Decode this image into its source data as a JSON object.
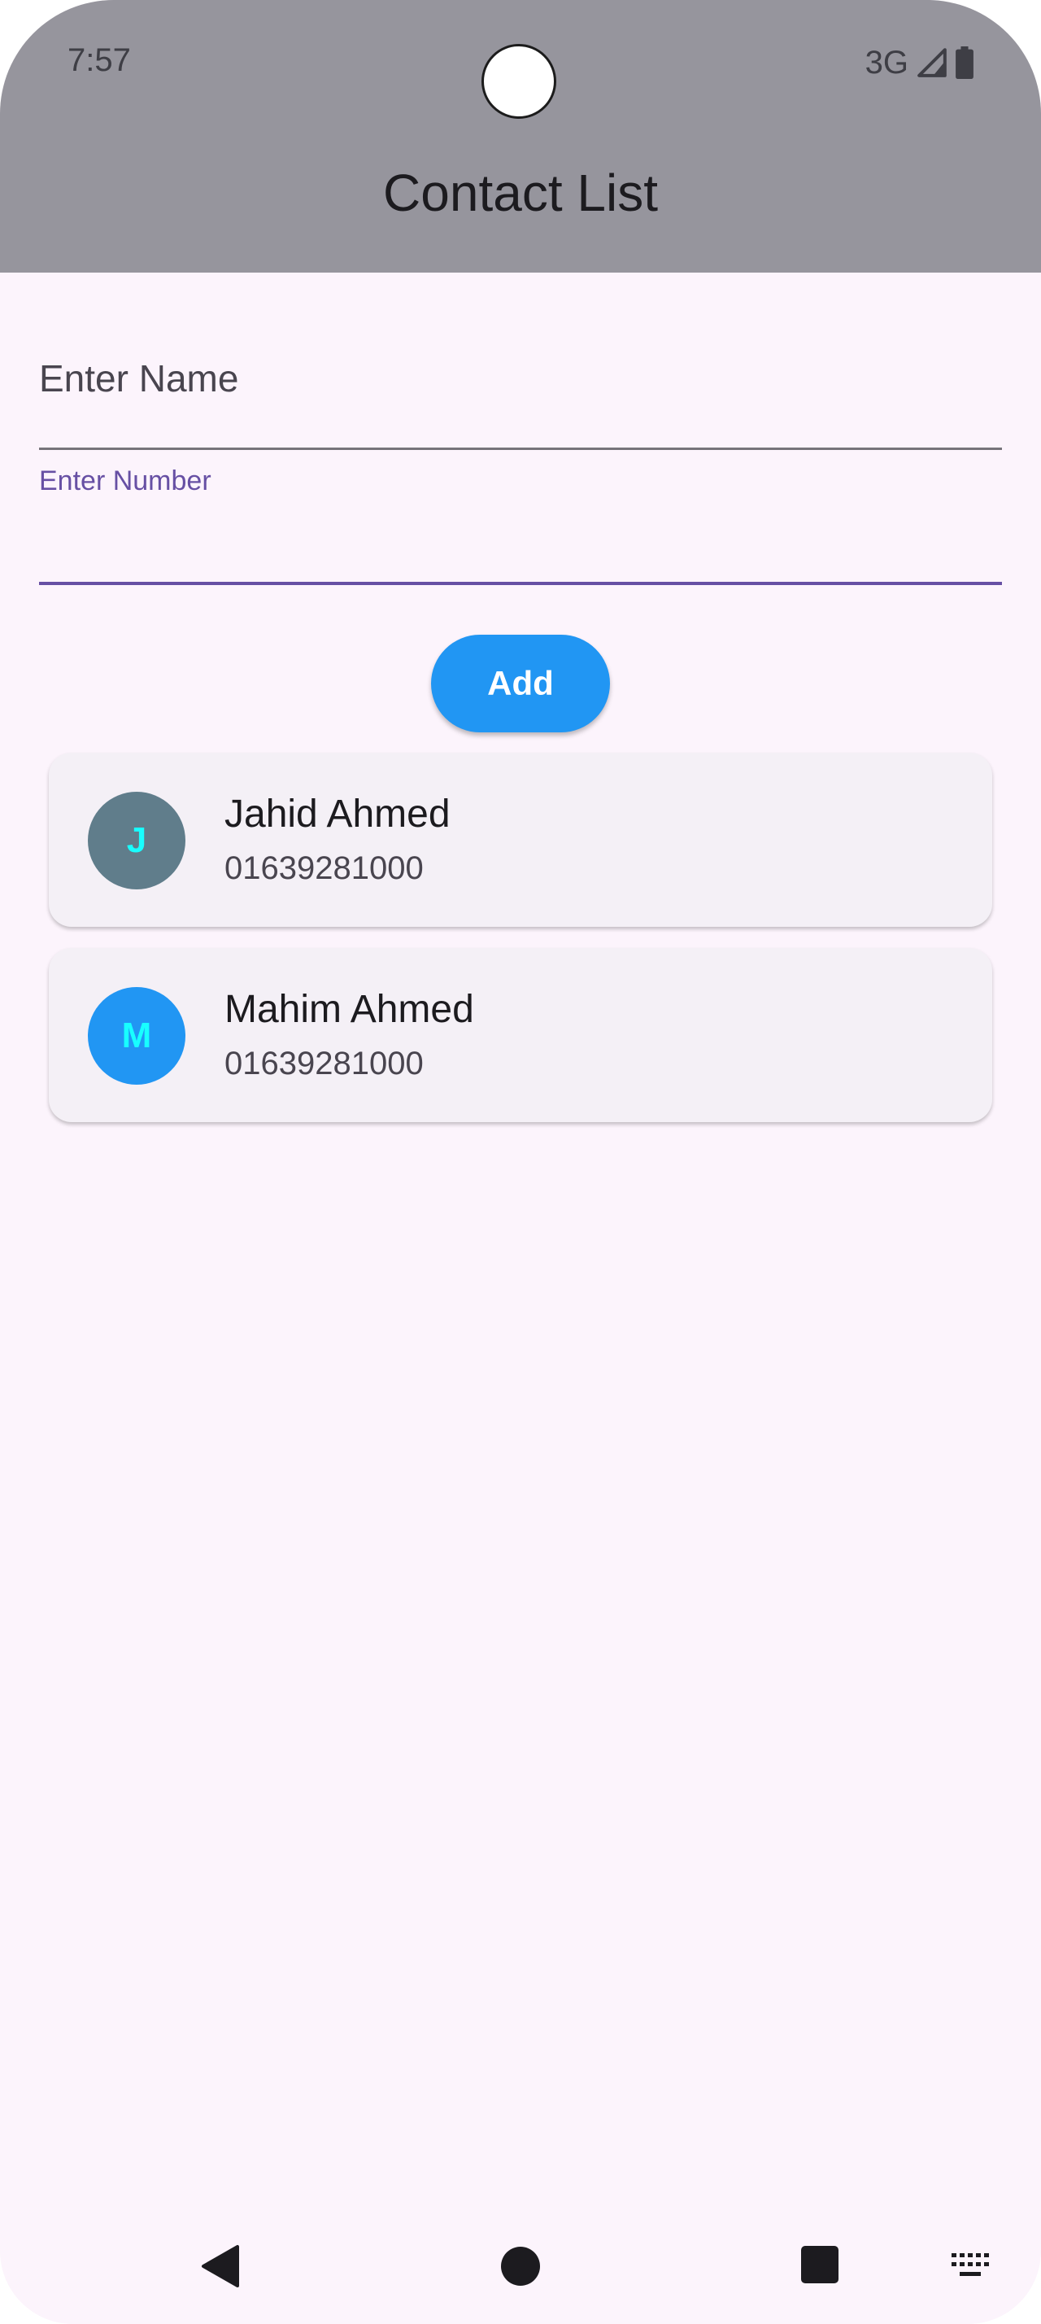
{
  "status_bar": {
    "time": "7:57",
    "network": "3G",
    "icons": [
      "signal-icon",
      "battery-icon"
    ]
  },
  "app_bar": {
    "title": "Contact List"
  },
  "form": {
    "name_label": "Enter Name",
    "name_value": "",
    "number_label": "Enter Number",
    "number_value": "",
    "add_label": "Add"
  },
  "contacts": [
    {
      "initial": "J",
      "name": "Jahid Ahmed",
      "number": "01639281000",
      "avatar_color": "#607d8b"
    },
    {
      "initial": "M",
      "name": "Mahim Ahmed",
      "number": "01639281000",
      "avatar_color": "#2196f3"
    }
  ],
  "navigation": {
    "icons": [
      "back-icon",
      "home-icon",
      "recents-icon",
      "keyboard-icon"
    ]
  },
  "colors": {
    "app_bar": "#96959d",
    "background": "#fcf4fc",
    "accent": "#6750a4",
    "button": "#2196f3",
    "initial_text": "#18ffff"
  }
}
